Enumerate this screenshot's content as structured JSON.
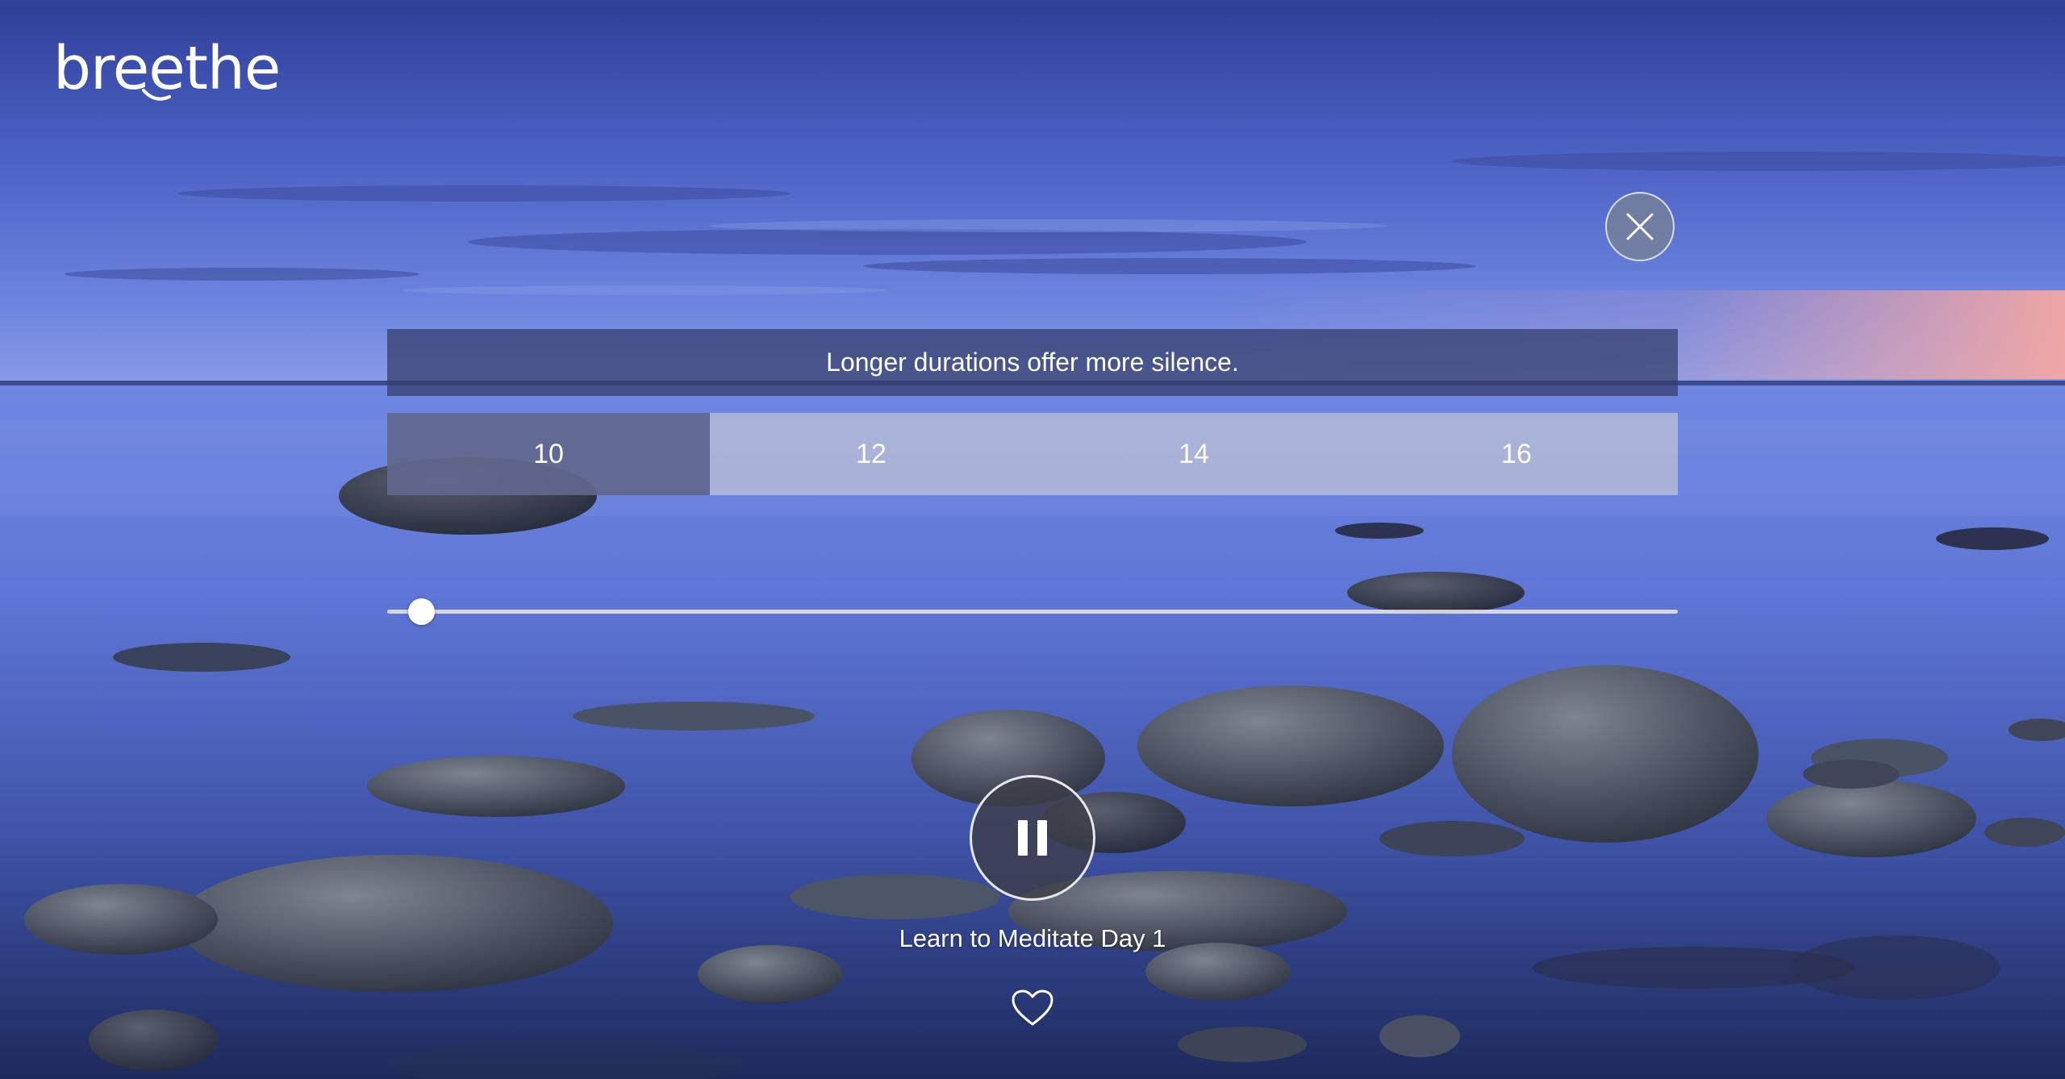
{
  "app": {
    "logo_text": "breethe"
  },
  "banner": {
    "message": "Longer durations offer more silence."
  },
  "durations": {
    "options": [
      "10",
      "12",
      "14",
      "16"
    ],
    "selected": "10"
  },
  "player": {
    "progress": 0.026,
    "state": "playing",
    "track_title": "Learn to Meditate Day 1"
  },
  "icons": {
    "close": "close-icon",
    "pause": "pause-icon",
    "favorite": "heart-outline-icon"
  },
  "colors": {
    "sky_top": "#3a4aa3",
    "sunset_glow": "#f2a0a8",
    "water": "#5a6fcf",
    "selected_duration": "#4e5680",
    "duration_bar": "#cdcdd4"
  }
}
